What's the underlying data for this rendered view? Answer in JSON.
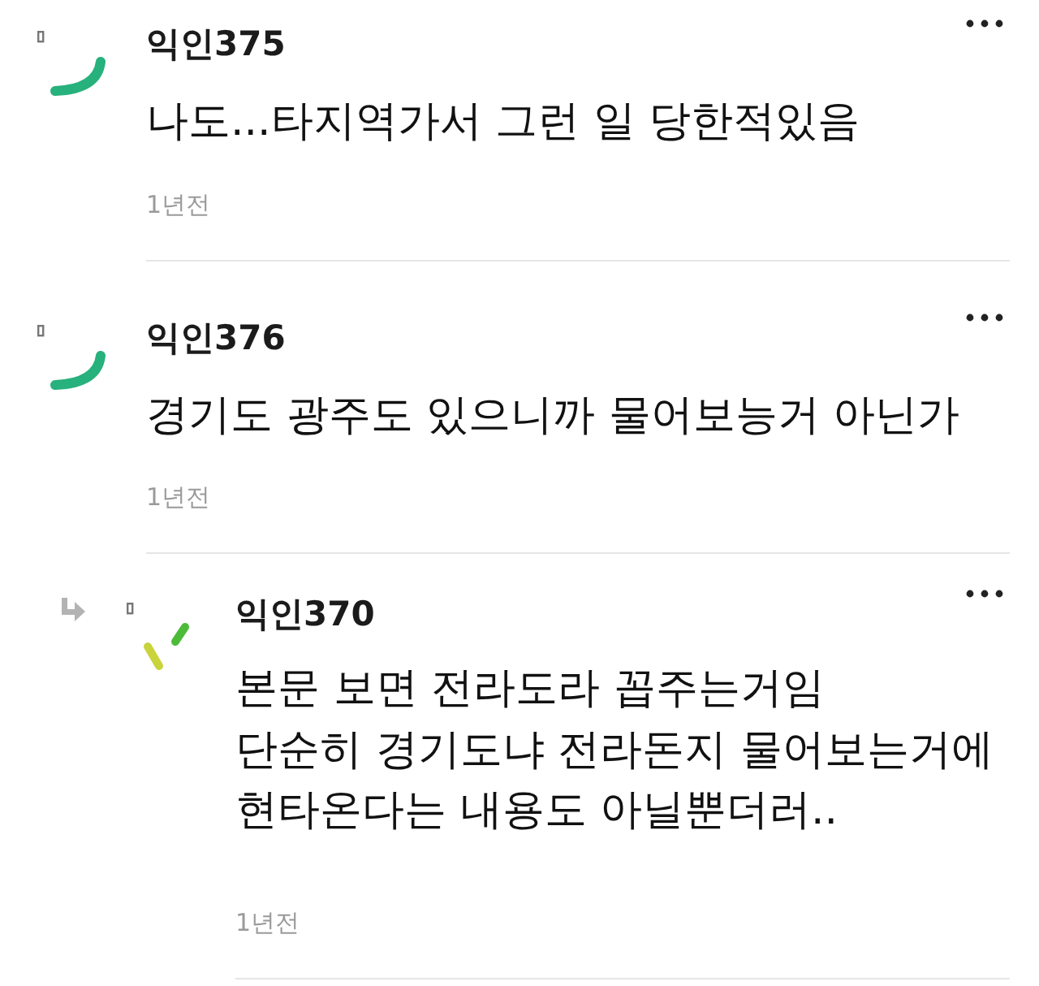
{
  "comments": [
    {
      "author": "익인375",
      "body": "나도...타지역가서 그런 일 당한적있음",
      "time": "1년전",
      "reply": false,
      "avatar": {
        "kind": "arc"
      }
    },
    {
      "author": "익인376",
      "body": "경기도 광주도 있으니까 물어보능거 아닌가",
      "time": "1년전",
      "reply": false,
      "avatar": {
        "kind": "arc"
      }
    },
    {
      "author": "익인370",
      "body": "본문 보면 전라도라 꼽주는거임\n단순히 경기도냐 전라돈지 물어보는거에\n현타온다는 내용도 아닐뿐더러..",
      "time": "1년전",
      "reply": true,
      "avatar": {
        "kind": "bars"
      }
    }
  ]
}
